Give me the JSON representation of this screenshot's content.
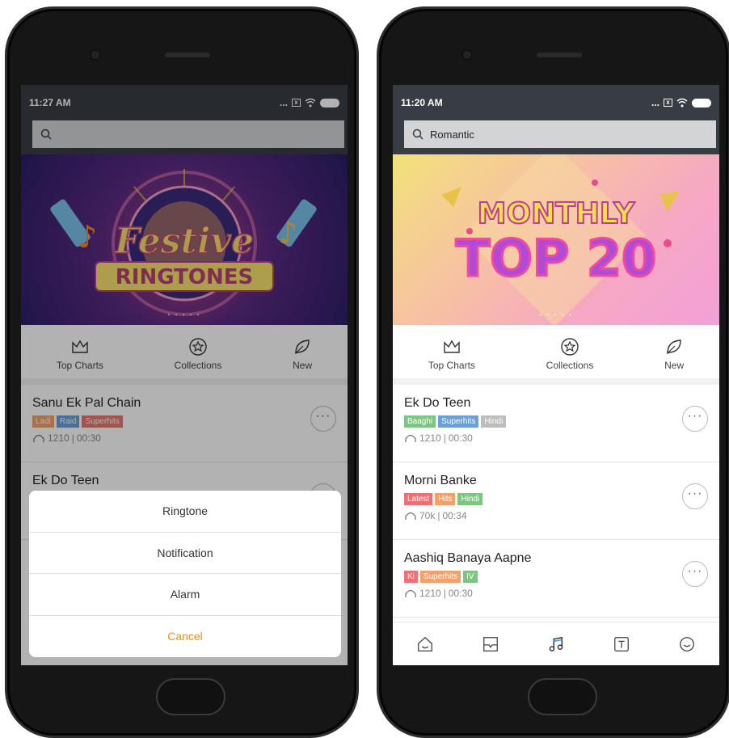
{
  "left_phone": {
    "status": {
      "time": "11:27 AM",
      "dots": "..."
    },
    "search": {
      "placeholder": ""
    },
    "banner": {
      "line1": "Festive",
      "line2": "RINGTONES"
    },
    "categories": [
      {
        "label": "Top Charts",
        "icon": "crown-icon"
      },
      {
        "label": "Collections",
        "icon": "star-badge-icon"
      },
      {
        "label": "New",
        "icon": "leaf-icon"
      }
    ],
    "songs": [
      {
        "title": "Sanu Ek Pal Chain",
        "tags": [
          "Ladi",
          "Raid",
          "Superhits"
        ],
        "plays": "1210",
        "duration": "00:30"
      },
      {
        "title": "Ek Do Teen",
        "tags": [],
        "plays": "",
        "duration": ""
      }
    ],
    "action_sheet": {
      "items": [
        "Ringtone",
        "Notification",
        "Alarm"
      ],
      "cancel": "Cancel"
    }
  },
  "right_phone": {
    "status": {
      "time": "11:20 AM",
      "dots": "..."
    },
    "search": {
      "value": "Romantic"
    },
    "banner": {
      "line1": "MONTHLY",
      "line2": "TOP 20"
    },
    "categories": [
      {
        "label": "Top Charts",
        "icon": "crown-icon"
      },
      {
        "label": "Collections",
        "icon": "star-badge-icon"
      },
      {
        "label": "New",
        "icon": "leaf-icon"
      }
    ],
    "songs": [
      {
        "title": "Ek Do Teen",
        "tags": [
          "Baaghi",
          "Superhits",
          "Hindi"
        ],
        "plays": "1210",
        "duration": "00:30"
      },
      {
        "title": "Morni Banke",
        "tags": [
          "Latest",
          "Hits",
          "Hindi"
        ],
        "plays": "70k",
        "duration": "00:34"
      },
      {
        "title": "Aashiq Banaya Aapne",
        "tags": [
          "Ki",
          "Superhits",
          "IV"
        ],
        "plays": "1210",
        "duration": "00:30"
      }
    ],
    "tabbar": [
      "home-icon",
      "inbox-icon",
      "music-note-icon",
      "text-icon",
      "smiley-icon"
    ]
  },
  "colors": {
    "accent": "#f08c1a",
    "statusbar": "#383d44"
  }
}
